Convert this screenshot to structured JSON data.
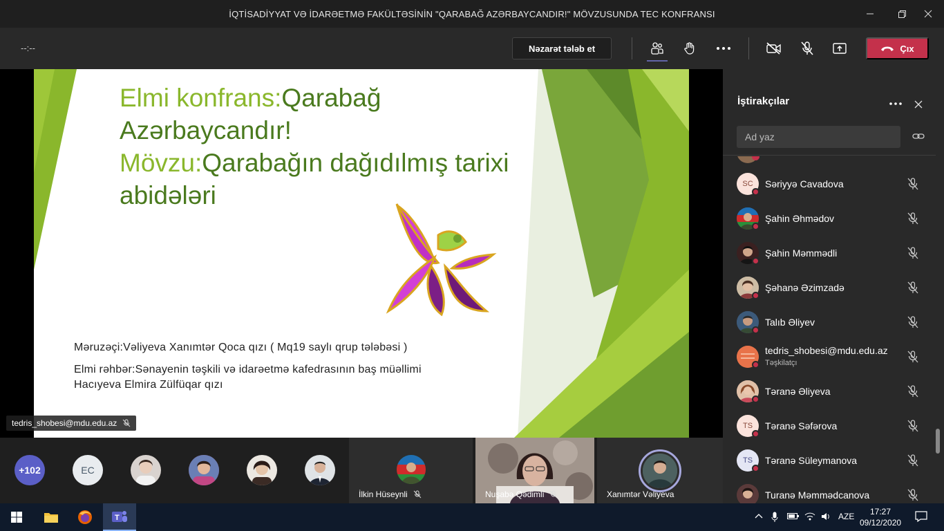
{
  "window": {
    "title": "İQTİSADİYYAT VƏ İDARƏETMƏ FAKÜLTƏSİNİN \"QARABAĞ AZƏRBAYCANDIR!\" MÖVZUSUNDA TEC KONFRANSI"
  },
  "toolbar": {
    "timer": "--:--",
    "request_control_label": "Nəzarət tələb et",
    "leave_label": "Çıx"
  },
  "slide": {
    "title_line1_a": "Elmi konfrans:",
    "title_line1_b": "Qarabağ",
    "title_line2": "Azərbaycandır!",
    "title_line3_a": "Mövzu:",
    "title_line3_b": "Qarabağın dağıdılmış tarixi",
    "title_line4": "abidələri",
    "speaker": "Məruzəçi:Vəliyeva Xanımtər Qoca qızı ( Mq19 saylı qrup tələbəsi )",
    "advisor_line1": "Elmi rəhbər:Sənayenin təşkili və idarəetmə kafedrasının baş müəllimi",
    "advisor_line2": "Hacıyeva Elmira Zülfüqar qızı",
    "presenter": "tedris_shobesi@mdu.edu.az"
  },
  "gallery": {
    "more_count": "+102",
    "ec_initials": "EC",
    "tiles": [
      {
        "name": "İlkin Hüseynli"
      },
      {
        "name": "Nuşabə Qədimli"
      },
      {
        "name": "Xanımtər Vəliyeva"
      }
    ]
  },
  "panel": {
    "title": "İştirakçılar",
    "search_placeholder": "Ad yaz",
    "participants": [
      {
        "name": "Səriyyə Cavadova",
        "initials": "SC",
        "role": ""
      },
      {
        "name": "Şahin Əhmədov",
        "initials": "",
        "role": ""
      },
      {
        "name": "Şahin Məmmədli",
        "initials": "",
        "role": ""
      },
      {
        "name": "Şəhanə Əzimzadə",
        "initials": "",
        "role": ""
      },
      {
        "name": "Talıb Əliyev",
        "initials": "",
        "role": ""
      },
      {
        "name": "tedris_shobesi@mdu.edu.az",
        "initials": "",
        "role": "Təşkilatçı"
      },
      {
        "name": "Təranə Əliyeva",
        "initials": "",
        "role": ""
      },
      {
        "name": "Təranə Səfərova",
        "initials": "TS",
        "role": ""
      },
      {
        "name": "Təranə Süleymanova",
        "initials": "TS",
        "role": ""
      },
      {
        "name": "Turanə Məmmədcanova",
        "initials": "",
        "role": ""
      }
    ]
  },
  "taskbar": {
    "language": "AZE",
    "time": "17:27",
    "date": "09/12/2020"
  },
  "colors": {
    "accent": "#6264a7",
    "leave": "#c4314b",
    "slide_green_dark": "#4a7a1e",
    "slide_green_light": "#8ab72c"
  }
}
